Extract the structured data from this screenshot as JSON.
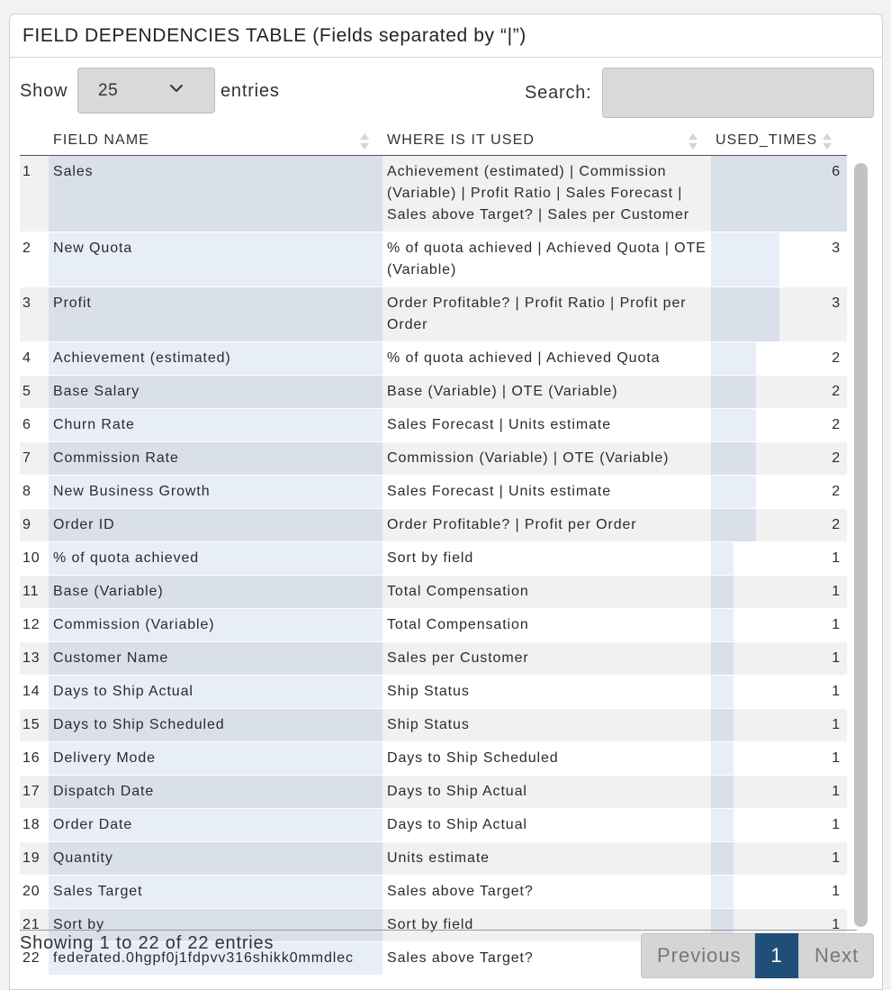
{
  "panel": {
    "title": "FIELD DEPENDENCIES TABLE (Fields separated by “|”)"
  },
  "controls": {
    "show_label": "Show",
    "page_length": "25",
    "entries_label": "entries",
    "search_label": "Search:",
    "search_value": ""
  },
  "table": {
    "columns": [
      "FIELD NAME",
      "WHERE IS IT USED",
      "USED_TIMES"
    ],
    "max_used_times": 6,
    "rows": [
      {
        "idx": "1",
        "field": "Sales",
        "where": "Achievement (estimated) | Commission (Variable) | Profit Ratio | Sales Forecast | Sales above Target? | Sales per Customer",
        "used": 6
      },
      {
        "idx": "2",
        "field": "New Quota",
        "where": "% of quota achieved | Achieved Quota | OTE (Variable)",
        "used": 3
      },
      {
        "idx": "3",
        "field": "Profit",
        "where": "Order Profitable? | Profit Ratio | Profit per Order",
        "used": 3
      },
      {
        "idx": "4",
        "field": "Achievement (estimated)",
        "where": "% of quota achieved | Achieved Quota",
        "used": 2
      },
      {
        "idx": "5",
        "field": "Base Salary",
        "where": "Base (Variable) | OTE (Variable)",
        "used": 2
      },
      {
        "idx": "6",
        "field": "Churn Rate",
        "where": "Sales Forecast | Units estimate",
        "used": 2
      },
      {
        "idx": "7",
        "field": "Commission Rate",
        "where": "Commission (Variable) | OTE (Variable)",
        "used": 2
      },
      {
        "idx": "8",
        "field": "New Business Growth",
        "where": "Sales Forecast | Units estimate",
        "used": 2
      },
      {
        "idx": "9",
        "field": "Order ID",
        "where": "Order Profitable? | Profit per Order",
        "used": 2
      },
      {
        "idx": "10",
        "field": "% of quota achieved",
        "where": "Sort by field",
        "used": 1
      },
      {
        "idx": "11",
        "field": "Base (Variable)",
        "where": "Total Compensation",
        "used": 1
      },
      {
        "idx": "12",
        "field": "Commission (Variable)",
        "where": "Total Compensation",
        "used": 1
      },
      {
        "idx": "13",
        "field": "Customer Name",
        "where": "Sales per Customer",
        "used": 1
      },
      {
        "idx": "14",
        "field": "Days to Ship Actual",
        "where": "Ship Status",
        "used": 1
      },
      {
        "idx": "15",
        "field": "Days to Ship Scheduled",
        "where": "Ship Status",
        "used": 1
      },
      {
        "idx": "16",
        "field": "Delivery Mode",
        "where": "Days to Ship Scheduled",
        "used": 1
      },
      {
        "idx": "17",
        "field": "Dispatch Date",
        "where": "Days to Ship Actual",
        "used": 1
      },
      {
        "idx": "18",
        "field": "Order Date",
        "where": "Days to Ship Actual",
        "used": 1
      },
      {
        "idx": "19",
        "field": "Quantity",
        "where": "Units estimate",
        "used": 1
      },
      {
        "idx": "20",
        "field": "Sales Target",
        "where": "Sales above Target?",
        "used": 1
      },
      {
        "idx": "21",
        "field": "Sort by",
        "where": "Sort by field",
        "used": 1
      },
      {
        "idx": "22",
        "field": "federated.0hgpf0j1fdpvv316shikk0mmdlec",
        "where": "Sales above Target?",
        "used": 1
      }
    ]
  },
  "footer": {
    "info": "Showing 1 to 22 of 22 entries",
    "prev_label": "Previous",
    "current_page": "1",
    "next_label": "Next"
  },
  "colors": {
    "active_page": "#1f4e79",
    "bar_fill": "#dae0ea"
  }
}
